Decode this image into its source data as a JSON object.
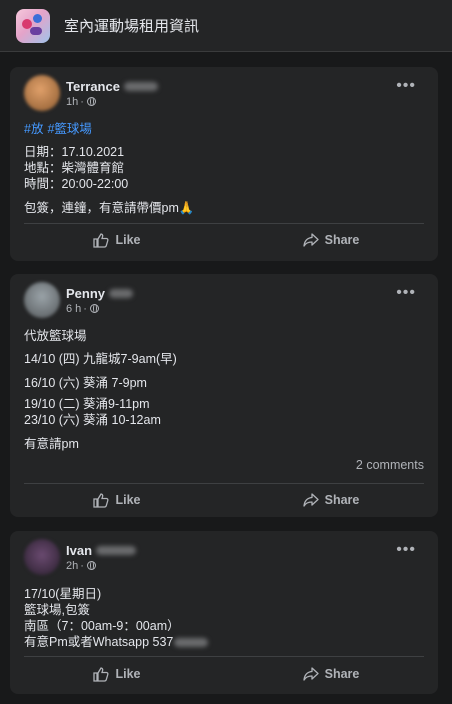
{
  "group": {
    "title": "室內運動場租用資訊",
    "icon": "group-icon"
  },
  "actions": {
    "like": "Like",
    "share": "Share"
  },
  "posts": [
    {
      "author": "Terrance",
      "time": "1h",
      "hashtags": [
        "#放",
        "#籃球場"
      ],
      "lines": [
        "日期：17.10.2021",
        "地點：柴灣體育館",
        "時間：20:00-22:00",
        "包簽，連鐘，有意請帶價pm🙏"
      ],
      "avatar_color": "#c07a3c"
    },
    {
      "author": "Penny",
      "time": "6 h",
      "lines": [
        "代放籃球場",
        "14/10 (四) 九龍城7-9am(早)",
        "16/10 (六) 葵涌 7-9pm",
        "19/10 (二) 葵涌9-11pm",
        "23/10 (六) 葵涌 10-12am",
        "有意請pm"
      ],
      "comments": "2 comments",
      "avatar_color": "#8a9296"
    },
    {
      "author": "Ivan",
      "time": "2h",
      "lines": [
        "17/10(星期日)",
        "籃球場,包簽",
        "南區（7：00am-9：00am）",
        "有意Pm或者Whatsapp 537"
      ],
      "avatar_color": "#4a3350"
    }
  ]
}
